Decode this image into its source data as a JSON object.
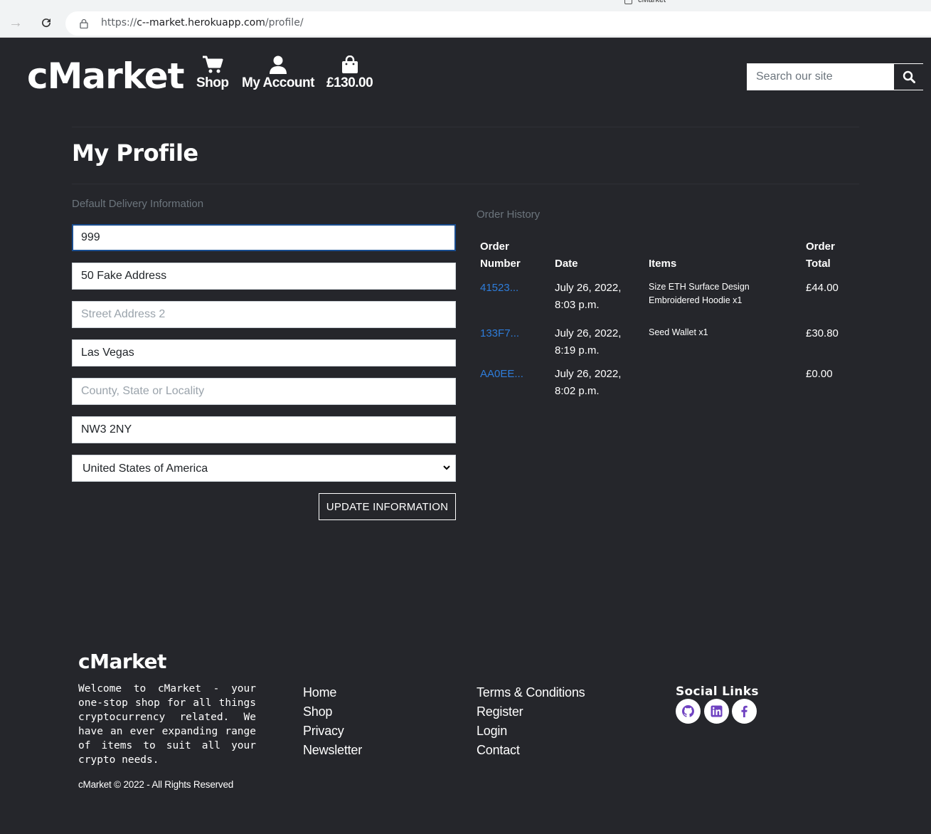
{
  "browser": {
    "tab_title": "cMarket",
    "url_prefix": "https://",
    "url_host": "c--market.herokuapp.com",
    "url_path": "/profile/"
  },
  "header": {
    "logo": "cMarket",
    "nav": {
      "shop_label": "Shop",
      "account_label": "My Account",
      "cart_total": "£130.00"
    },
    "search_placeholder": "Search our site"
  },
  "page": {
    "title": "My Profile"
  },
  "delivery": {
    "section_label": "Default Delivery Information",
    "phone": "999",
    "street_address1": "50 Fake Address",
    "street_address2_placeholder": "Street Address 2",
    "town": "Las Vegas",
    "county_placeholder": "County, State or Locality",
    "postcode": "NW3 2NY",
    "country": "United States of America",
    "update_button": "UPDATE INFORMATION"
  },
  "orders": {
    "section_label": "Order History",
    "headers": {
      "number_line1": "Order",
      "number_line2": "Number",
      "date": "Date",
      "items": "Items",
      "total_line1": "Order",
      "total_line2": "Total"
    },
    "rows": [
      {
        "number": "41523...",
        "date_line1": "July 26, 2022,",
        "date_line2": "8:03 p.m.",
        "items_line1": "Size ETH Surface Design",
        "items_line2": "Embroidered Hoodie x1",
        "total": "£44.00"
      },
      {
        "number": "133F7...",
        "date_line1": "July 26, 2022,",
        "date_line2": "8:19 p.m.",
        "items_line1": "Seed Wallet x1",
        "items_line2": "",
        "total": "£30.80"
      },
      {
        "number": "AA0EE...",
        "date_line1": "July 26, 2022,",
        "date_line2": "8:02 p.m.",
        "items_line1": "",
        "items_line2": "",
        "total": "£0.00"
      }
    ]
  },
  "footer": {
    "logo": "cMarket",
    "description": "Welcome to cMarket - your one-stop shop for all things cryptocurrency related. We have an ever expanding range of items to suit all your crypto needs.",
    "copyright": "cMarket © 2022 - All Rights Reserved",
    "links_col1": [
      "Home",
      "Shop",
      "Privacy",
      "Newsletter"
    ],
    "links_col2": [
      "Terms & Conditions",
      "Register",
      "Login",
      "Contact"
    ],
    "social_title": "Social Links",
    "social_icons": [
      "github-icon",
      "linkedin-icon",
      "facebook-icon"
    ],
    "social_icon_color": "#6f42c1"
  }
}
